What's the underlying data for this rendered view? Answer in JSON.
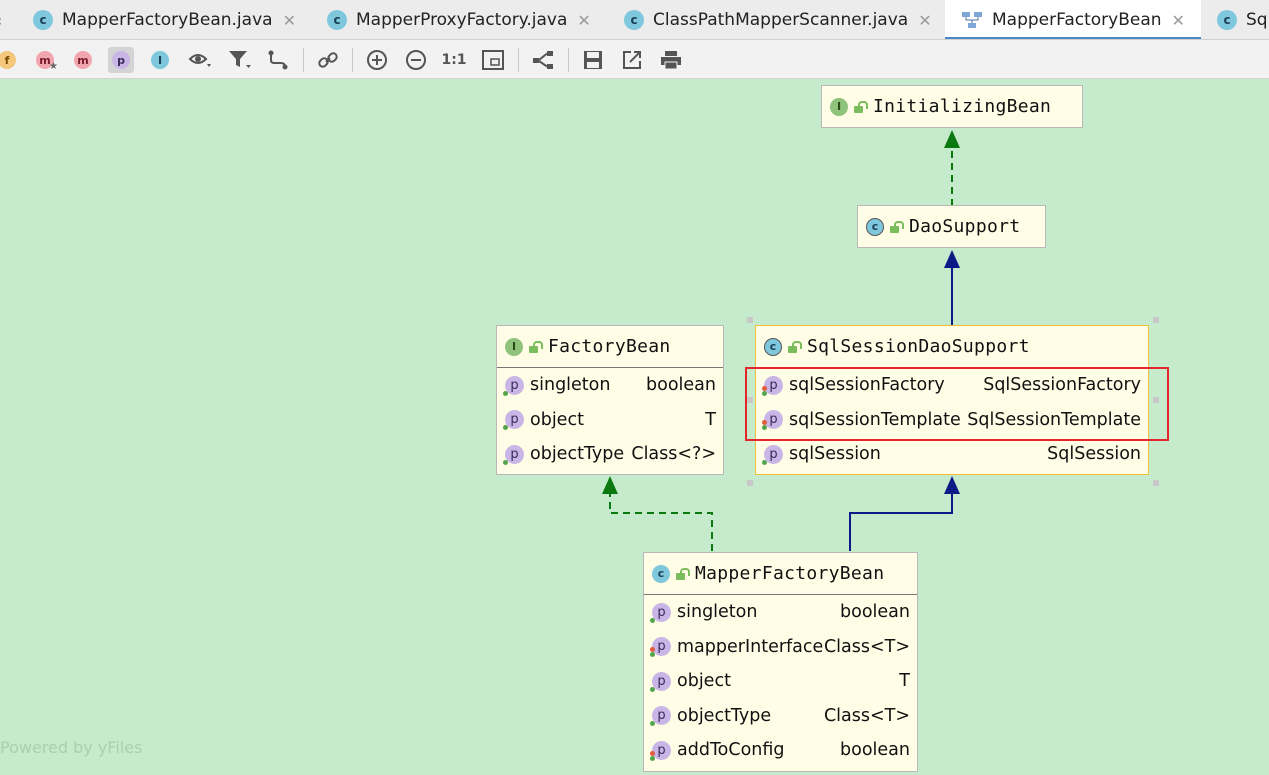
{
  "tabs": [
    {
      "label": "MapperFactoryBean.java",
      "icon": "class-icon",
      "active": false
    },
    {
      "label": "MapperProxyFactory.java",
      "icon": "class-icon",
      "active": false
    },
    {
      "label": "ClassPathMapperScanner.java",
      "icon": "class-icon",
      "active": false
    },
    {
      "label": "MapperFactoryBean",
      "icon": "diagram-icon",
      "active": true
    },
    {
      "label": "Sq",
      "icon": "class-icon",
      "active": false
    }
  ],
  "toolbar": {
    "ratio_label": "1:1",
    "letters": {
      "fields": "f",
      "methods": "m",
      "properties": "p",
      "inner": "I"
    }
  },
  "nodes": {
    "initializing_bean": {
      "name": "InitializingBean",
      "kind": "I"
    },
    "dao_support": {
      "name": "DaoSupport",
      "kind": "C"
    },
    "factory_bean": {
      "name": "FactoryBean",
      "kind": "I",
      "props": [
        {
          "name": "singleton",
          "type": "boolean"
        },
        {
          "name": "object",
          "type": "T"
        },
        {
          "name": "objectType",
          "type": "Class<?>"
        }
      ]
    },
    "sql_session_dao_support": {
      "name": "SqlSessionDaoSupport",
      "kind": "C",
      "props": [
        {
          "name": "sqlSessionFactory",
          "type": "SqlSessionFactory"
        },
        {
          "name": "sqlSessionTemplate",
          "type": "SqlSessionTemplate"
        },
        {
          "name": "sqlSession",
          "type": "SqlSession"
        }
      ]
    },
    "mapper_factory_bean": {
      "name": "MapperFactoryBean",
      "kind": "C",
      "props": [
        {
          "name": "singleton",
          "type": "boolean"
        },
        {
          "name": "mapperInterface",
          "type": "Class<T>"
        },
        {
          "name": "object",
          "type": "T"
        },
        {
          "name": "objectType",
          "type": "Class<T>"
        },
        {
          "name": "addToConfig",
          "type": "boolean"
        }
      ]
    }
  },
  "colors": {
    "canvas": "#c6ebcc",
    "interface_edge": "#0a7a10",
    "extends_edge": "#0b1a86",
    "highlight": "#e5242b"
  },
  "watermark": "Powered by yFiles"
}
